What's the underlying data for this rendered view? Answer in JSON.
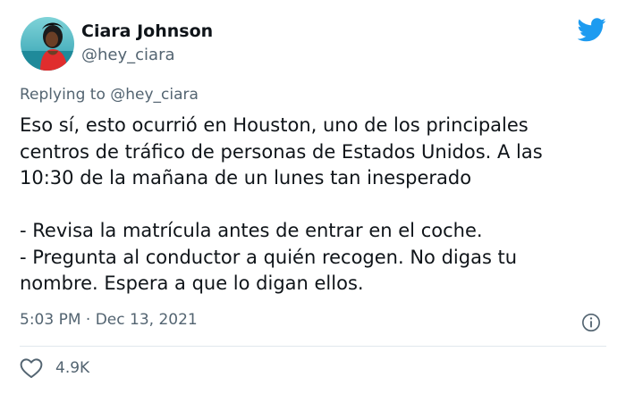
{
  "author": {
    "name": "Ciara Johnson",
    "handle": "@hey_ciara",
    "avatar_icon": "profile-photo",
    "brand_icon": "twitter-bird-icon",
    "brand_color": "#1d9bf0"
  },
  "reply": {
    "prefix": "Replying to",
    "mention": "@hey_ciara"
  },
  "body": {
    "line1": "Eso sí, esto ocurrió en Houston, uno de los principales",
    "line2": "centros de tráfico de personas de Estados Unidos. A las",
    "line3": "10:30 de la mañana de un lunes tan inesperado",
    "line4": "- Revisa la matrícula antes de entrar en el coche.",
    "line5": "- Pregunta al conductor a quién recogen. No digas tu",
    "line6": "nombre. Espera a que lo digan ellos."
  },
  "meta": {
    "time": "5:03 PM",
    "separator": "·",
    "date": "Dec 13, 2021",
    "info_icon": "info-icon"
  },
  "actions": {
    "like_icon": "heart-icon",
    "like_count": "4.9K"
  }
}
